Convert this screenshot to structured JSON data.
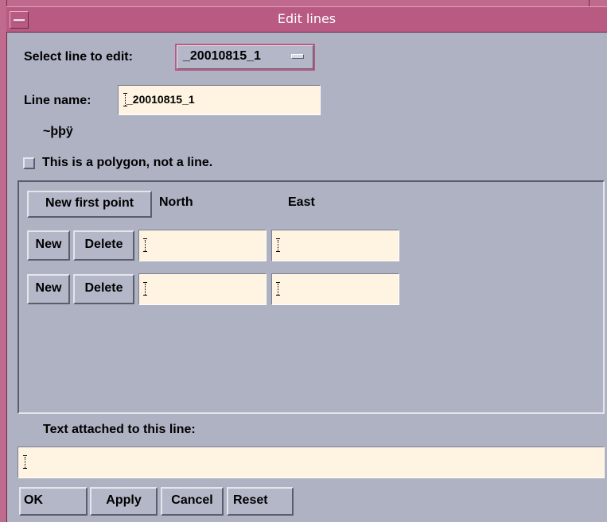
{
  "window": {
    "title": "Edit lines"
  },
  "select_line": {
    "label": "Select line to edit:",
    "value": "_20010815_1"
  },
  "line_name": {
    "label": "Line name:",
    "value": "_20010815_1"
  },
  "garbled_text": "~þþÿ",
  "polygon_checkbox": {
    "label": "This is a polygon, not a line.",
    "checked": false
  },
  "points": {
    "new_first_point_label": "New first point",
    "north_header": "North",
    "east_header": "East",
    "rows": [
      {
        "new_label": "New",
        "delete_label": "Delete",
        "north": "",
        "east": ""
      },
      {
        "new_label": "New",
        "delete_label": "Delete",
        "north": "",
        "east": ""
      }
    ]
  },
  "attached_text": {
    "label": "Text attached to this line:",
    "value": ""
  },
  "actions": {
    "ok": "OK",
    "apply": "Apply",
    "cancel": "Cancel",
    "reset": "Reset"
  },
  "colors": {
    "background": "#aeb2c3",
    "titlebar": "#b85a82",
    "field_background": "#fff4e2"
  }
}
